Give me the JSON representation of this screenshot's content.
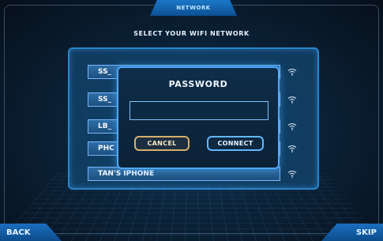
{
  "header": {
    "tab_label": "NETWORK",
    "subtitle": "SELECT YOUR WIFI NETWORK"
  },
  "networks": [
    {
      "label": "SS_",
      "icon": "wifi-icon"
    },
    {
      "label": "SS_",
      "icon": "wifi-icon"
    },
    {
      "label": "LB_",
      "icon": "wifi-icon"
    },
    {
      "label": "PHC",
      "icon": "wifi-icon"
    },
    {
      "label": "TAN'S IPHONE",
      "icon": "wifi-icon"
    }
  ],
  "password_dialog": {
    "title": "PASSWORD",
    "input_value": "",
    "cancel_label": "CANCEL",
    "connect_label": "CONNECT"
  },
  "footer": {
    "back_label": "BACK",
    "skip_label": "SKIP"
  },
  "colors": {
    "accent": "#2a84c9",
    "cancel_border": "#d5b06c",
    "connect_border": "#62b6ff"
  }
}
